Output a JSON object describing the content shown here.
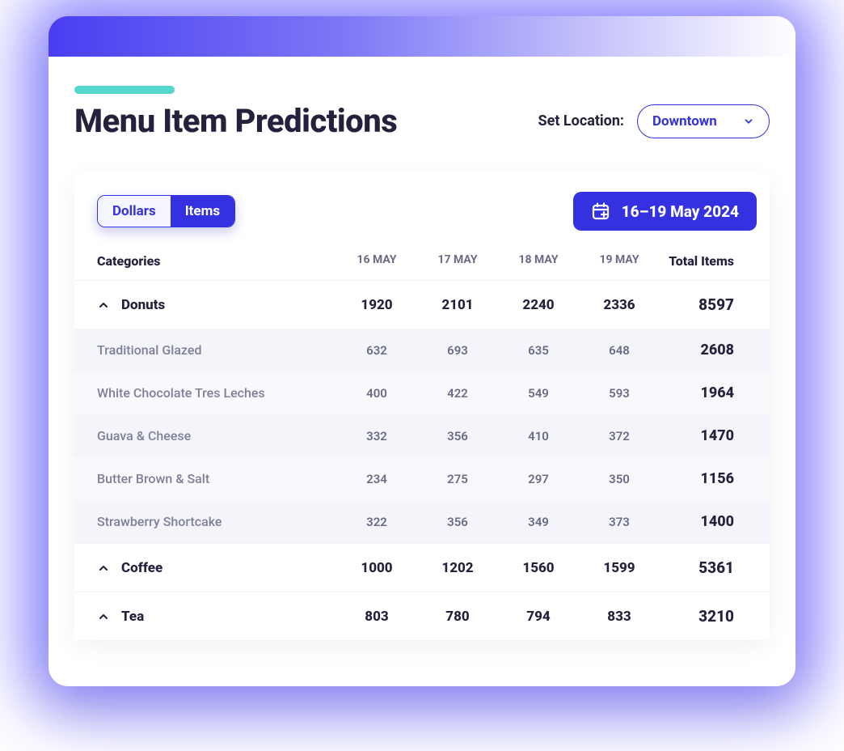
{
  "header": {
    "title": "Menu Item Predictions",
    "locationLabel": "Set Location:",
    "locationValue": "Downtown"
  },
  "controls": {
    "segment": {
      "dollars": "Dollars",
      "items": "Items"
    },
    "dateRange": "16–19 May 2024"
  },
  "table": {
    "head": {
      "categories": "Categories",
      "days": [
        "16 MAY",
        "17 MAY",
        "18 MAY",
        "19 MAY"
      ],
      "total": "Total Items"
    },
    "groups": [
      {
        "name": "Donuts",
        "days": [
          "1920",
          "2101",
          "2240",
          "2336"
        ],
        "total": "8597",
        "expanded": true,
        "items": [
          {
            "name": "Traditional Glazed",
            "days": [
              "632",
              "693",
              "635",
              "648"
            ],
            "total": "2608"
          },
          {
            "name": "White Chocolate Tres Leches",
            "days": [
              "400",
              "422",
              "549",
              "593"
            ],
            "total": "1964"
          },
          {
            "name": "Guava & Cheese",
            "days": [
              "332",
              "356",
              "410",
              "372"
            ],
            "total": "1470"
          },
          {
            "name": "Butter Brown & Salt",
            "days": [
              "234",
              "275",
              "297",
              "350"
            ],
            "total": "1156"
          },
          {
            "name": "Strawberry Shortcake",
            "days": [
              "322",
              "356",
              "349",
              "373"
            ],
            "total": "1400"
          }
        ]
      },
      {
        "name": "Coffee",
        "days": [
          "1000",
          "1202",
          "1560",
          "1599"
        ],
        "total": "5361",
        "expanded": false,
        "items": []
      },
      {
        "name": "Tea",
        "days": [
          "803",
          "780",
          "794",
          "833"
        ],
        "total": "3210",
        "expanded": false,
        "items": []
      }
    ]
  }
}
